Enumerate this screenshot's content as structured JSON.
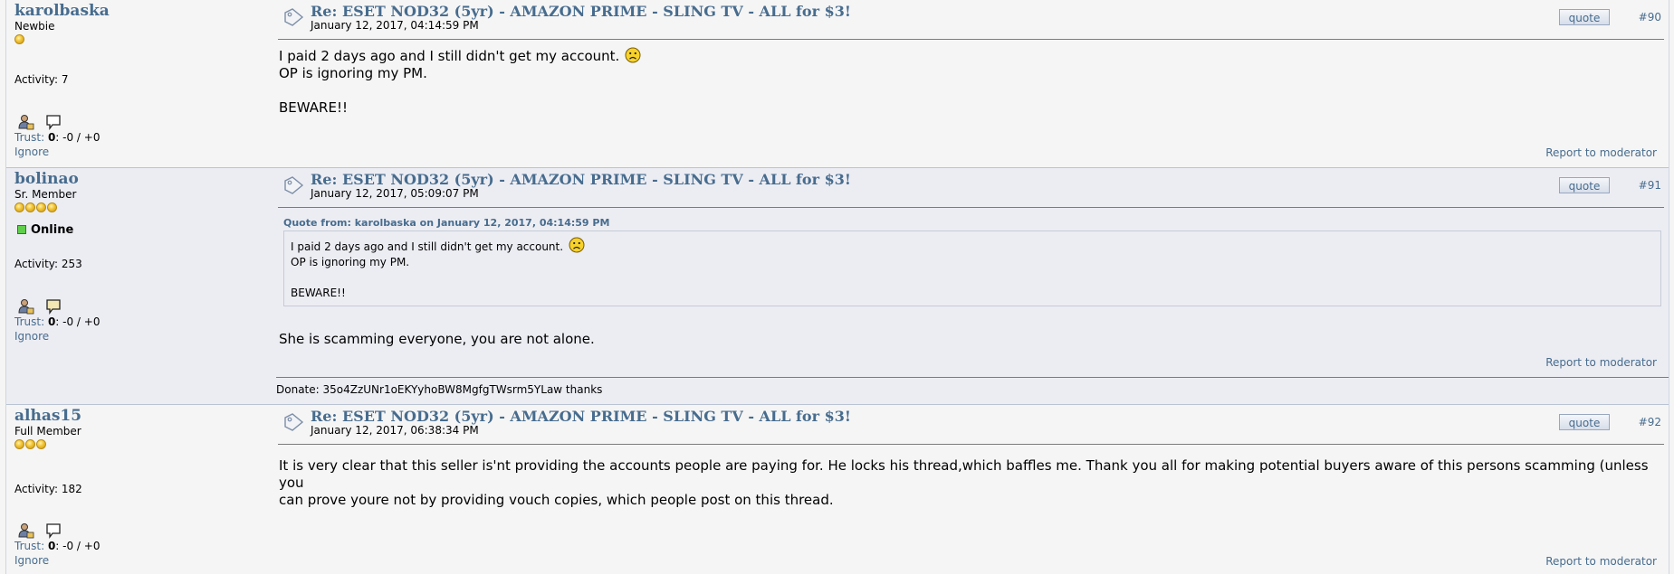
{
  "colors": {
    "link": "#476c8e",
    "post_bg_odd": "#f5f5f5",
    "post_bg_even": "#ecedf3",
    "online_green": "#5fcf4b",
    "coin_gold": "#f2c233"
  },
  "posts": [
    {
      "username": "karolbaska",
      "rank": "Newbie",
      "coins": 1,
      "online": false,
      "activity": "Activity: 7",
      "trust_label": "Trust:",
      "trust_score": "0",
      "trust_detail": ": -0 / +0",
      "ignore": "Ignore",
      "subject": "Re: ESET NOD32 (5yr) - AMAZON PRIME - SLING TV - ALL for $3!",
      "date": "January 12, 2017, 04:14:59 PM",
      "quote_btn": "quote",
      "number": "#90",
      "body": [
        "I paid 2 days ago and I still didn't get my account.",
        "OP is ignoring my PM.",
        "BEWARE!!"
      ],
      "smiley": "sad-smiley-icon",
      "report": "Report to moderator"
    },
    {
      "username": "bolinao",
      "rank": "Sr. Member",
      "coins": 4,
      "online": true,
      "online_label": "Online",
      "activity": "Activity: 253",
      "trust_label": "Trust:",
      "trust_score": "0",
      "trust_detail": ": -0 / +0",
      "ignore": "Ignore",
      "subject": "Re: ESET NOD32 (5yr) - AMAZON PRIME - SLING TV - ALL for $3!",
      "date": "January 12, 2017, 05:09:07 PM",
      "quote_btn": "quote",
      "number": "#91",
      "quote_header": "Quote from: karolbaska on January 12, 2017, 04:14:59 PM",
      "quote_lines": [
        "I paid 2 days ago and I still didn't get my account.",
        "OP is ignoring my PM.",
        "BEWARE!!"
      ],
      "body": [
        "She is scamming everyone, you are not alone."
      ],
      "report": "Report to moderator",
      "signature": "Donate: 35o4ZzUNr1oEKYyhoBW8MgfgTWsrm5YLaw  thanks"
    },
    {
      "username": "alhas15",
      "rank": "Full Member",
      "coins": 3,
      "online": false,
      "activity": "Activity: 182",
      "trust_label": "Trust:",
      "trust_score": "0",
      "trust_detail": ": -0 / +0",
      "ignore": "Ignore",
      "subject": "Re: ESET NOD32 (5yr) - AMAZON PRIME - SLING TV - ALL for $3!",
      "date": "January 12, 2017, 06:38:34 PM",
      "quote_btn": "quote",
      "number": "#92",
      "body": [
        "It is very clear that this seller is'nt providing the accounts people are paying for. He locks his thread,which baffles me. Thank you all for making potential buyers aware of this persons scamming (unless you",
        "can prove youre not by providing vouch copies, which people post on this thread."
      ],
      "report": "Report to moderator"
    }
  ]
}
